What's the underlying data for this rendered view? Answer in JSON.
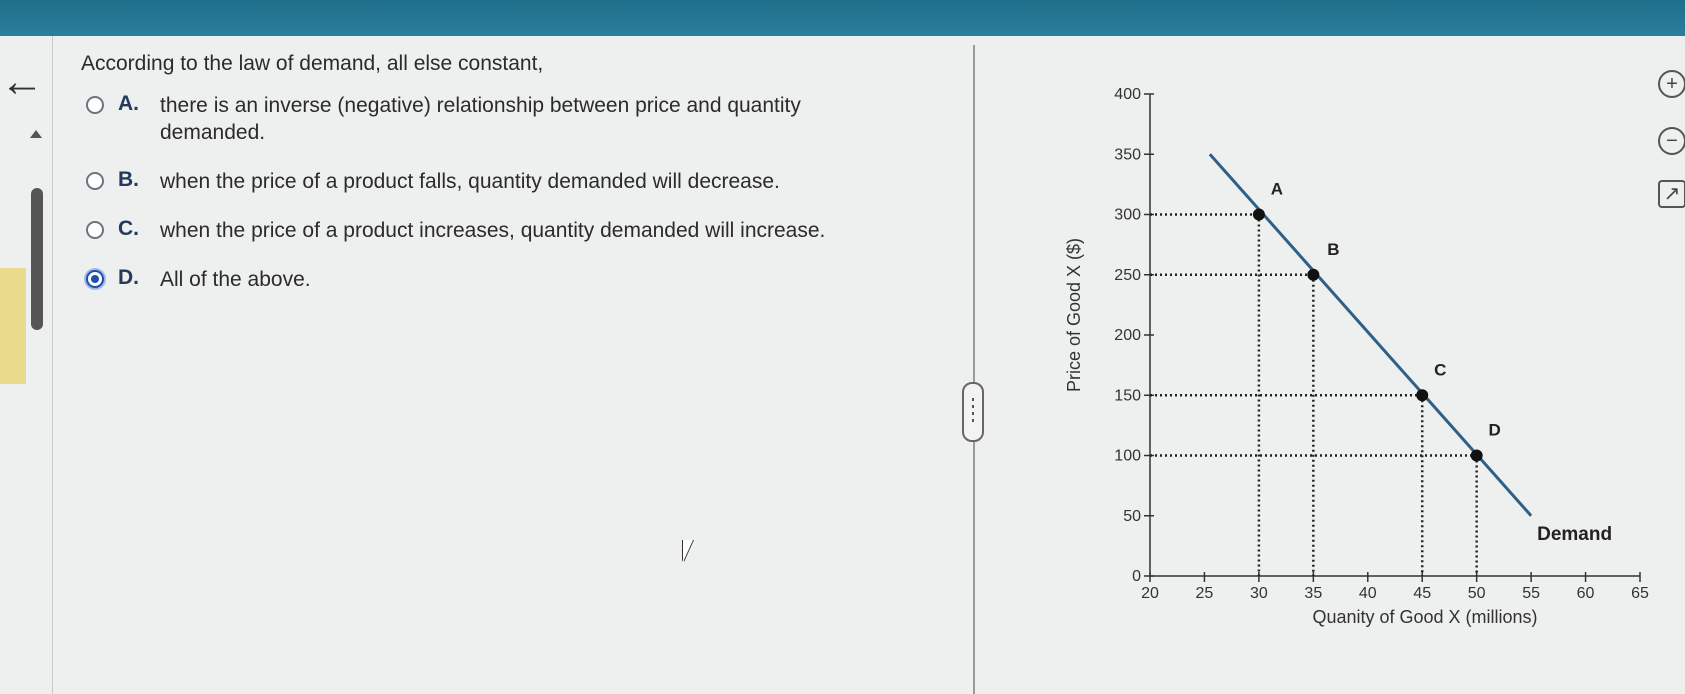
{
  "question": {
    "prompt": "According to the law of demand, all else constant,",
    "options": [
      {
        "letter": "A.",
        "text": "there is an inverse (negative) relationship between price and quantity demanded.",
        "selected": false
      },
      {
        "letter": "B.",
        "text": "when the price of a product falls, quantity demanded will decrease.",
        "selected": false
      },
      {
        "letter": "C.",
        "text": "when the price of a product increases, quantity demanded will increase.",
        "selected": false
      },
      {
        "letter": "D.",
        "text": "All of the above.",
        "selected": true
      }
    ]
  },
  "tools": {
    "zoom_in_icon": "zoom-in-icon",
    "zoom_out_icon": "zoom-out-icon",
    "popout_icon": "external-link-icon"
  },
  "colors": {
    "demand_line": "#2e5f86",
    "accent": "#1f4fa8",
    "header": "#1f6f8b"
  },
  "chart_data": {
    "type": "line",
    "xlabel": "Quanity of Good X (millions)",
    "ylabel": "Price of Good X ($)",
    "xlim": [
      20,
      65
    ],
    "ylim": [
      0,
      400
    ],
    "xticks": [
      20,
      25,
      30,
      35,
      40,
      45,
      50,
      55,
      60,
      65
    ],
    "yticks": [
      0,
      50,
      100,
      150,
      200,
      250,
      300,
      350,
      400
    ],
    "series": [
      {
        "name": "Demand",
        "x": [
          25.5,
          55
        ],
        "y": [
          350,
          50
        ]
      }
    ],
    "points": [
      {
        "label": "A",
        "x": 30,
        "y": 300
      },
      {
        "label": "B",
        "x": 35,
        "y": 250
      },
      {
        "label": "C",
        "x": 45,
        "y": 150
      },
      {
        "label": "D",
        "x": 50,
        "y": 100
      }
    ],
    "guides": "dotted"
  }
}
